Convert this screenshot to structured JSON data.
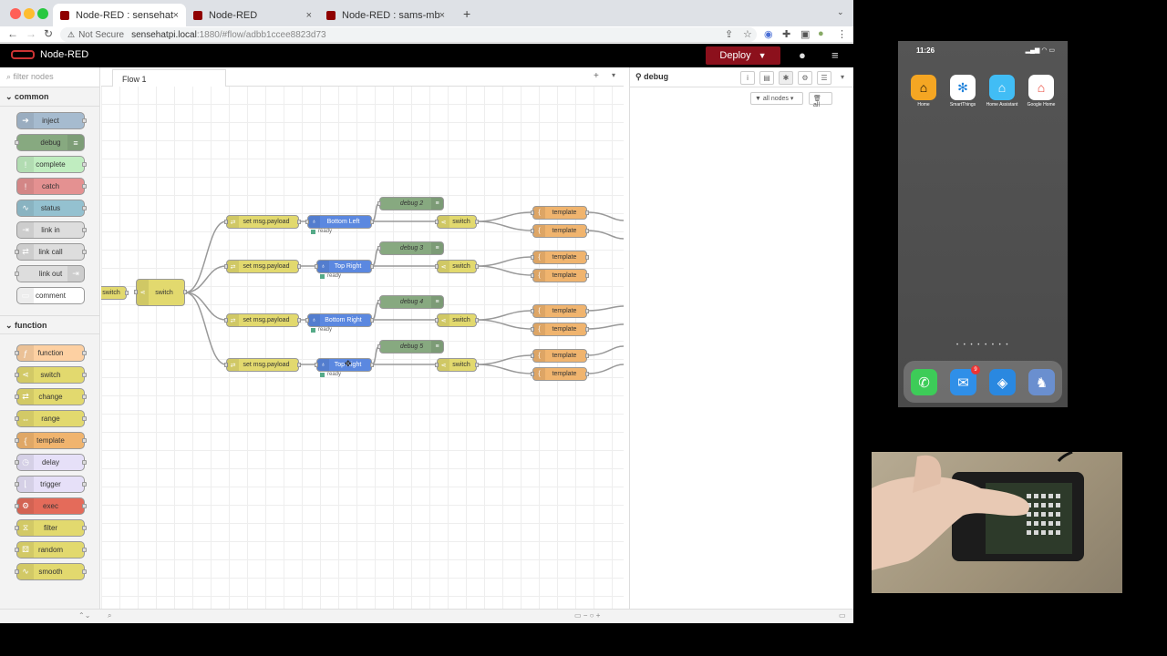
{
  "browser": {
    "tabs": [
      {
        "title": "Node-RED : sensehatpi.local",
        "close": "×"
      },
      {
        "title": "Node-RED",
        "close": "×"
      },
      {
        "title": "Node-RED : sams-mbp.local",
        "close": "×"
      }
    ],
    "new_tab": "+",
    "address": {
      "security": "Not Secure",
      "host": "sensehatpi.local",
      "path": ":1880/#flow/adbb1ccee8823d73"
    }
  },
  "nodered": {
    "brand": "Node-RED",
    "deploy_label": "Deploy",
    "palette": {
      "filter_placeholder": "filter nodes",
      "categories": [
        {
          "name": "common",
          "nodes": [
            "inject",
            "debug",
            "complete",
            "catch",
            "status",
            "link in",
            "link call",
            "link out",
            "comment"
          ]
        },
        {
          "name": "function",
          "nodes": [
            "function",
            "switch",
            "change",
            "range",
            "template",
            "delay",
            "trigger",
            "exec",
            "filter",
            "random",
            "smooth"
          ]
        }
      ]
    },
    "workspace": {
      "tab": "Flow 1",
      "nodes": {
        "switch_edge": "switch",
        "switch_main": "switch",
        "set_payload": "set msg.payload",
        "btn1": "Bottom Left",
        "btn2": "Top Right",
        "btn3": "Bottom Right",
        "btn4": "Top Right",
        "debug2": "debug 2",
        "debug3": "debug 3",
        "debug4": "debug 4",
        "debug5": "debug 5",
        "switch_r": "switch",
        "template": "template",
        "ready": "ready"
      }
    },
    "sidebar": {
      "tab": "debug",
      "filter": "all nodes",
      "clear": "all"
    }
  },
  "phone": {
    "time": "11:26",
    "apps": [
      {
        "label": "Home",
        "color": "#f5a623"
      },
      {
        "label": "SmartThings",
        "color": "#ffffff"
      },
      {
        "label": "Home Assistant",
        "color": "#41bdf5"
      },
      {
        "label": "Google Home",
        "color": "#ffffff"
      }
    ],
    "mail_badge": "9"
  }
}
